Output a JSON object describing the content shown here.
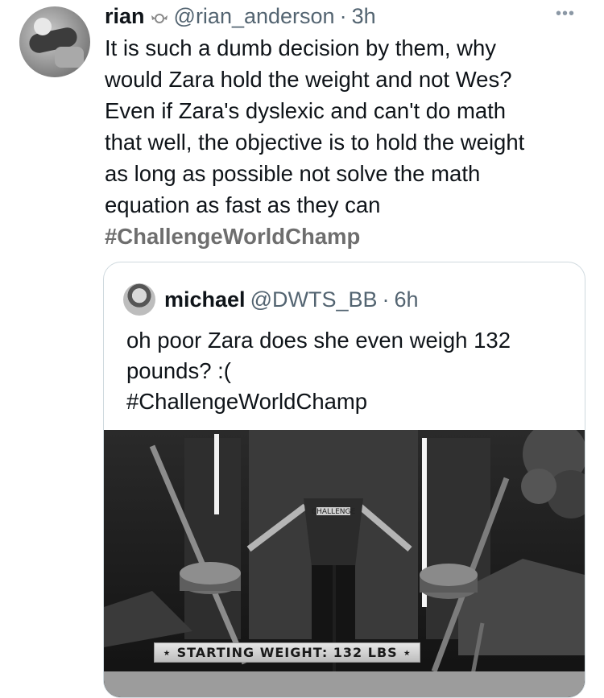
{
  "tweet": {
    "author_name": "rian",
    "author_badge_icon": "candy-icon",
    "handle": "@rian_anderson",
    "separator": "·",
    "time": "3h",
    "more_icon": "more-icon",
    "text_lines": [
      "It is such a dumb decision by them, why",
      "would Zara hold the weight and not Wes?",
      "Even if Zara's dyslexic and can't do math",
      "that well, the objective is to hold the weight",
      "as long as possible not solve the math",
      "equation as fast as they can"
    ],
    "hashtag": "#ChallengeWorldChamp"
  },
  "quote": {
    "author_name": "michael",
    "handle": "@DWTS_BB",
    "separator": "·",
    "time": "6h",
    "text_lines": [
      "oh poor Zara does she even weigh 132",
      "pounds? :("
    ],
    "hashtag": "#ChallengeWorldChamp",
    "media": {
      "banner_text": "⋆ STARTING WEIGHT: 132 LBS ⋆",
      "shirt_text": "CHALLENGE"
    }
  }
}
